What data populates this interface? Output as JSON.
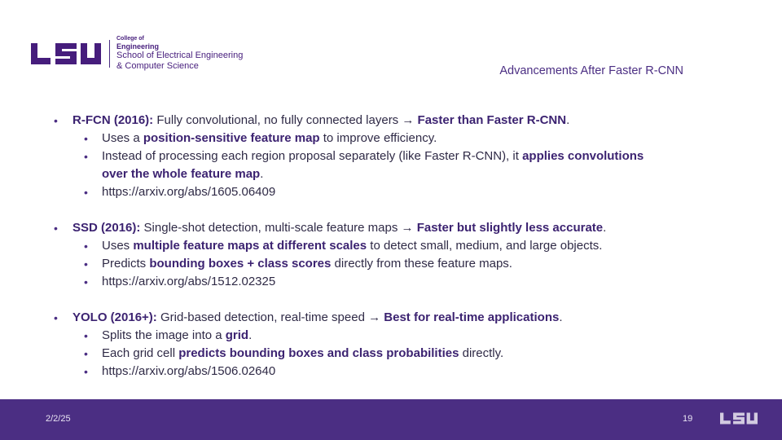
{
  "header": {
    "logo_text": "LSU",
    "college_of": "College of",
    "college_name": "Engineering",
    "school_line1": "School of Electrical Engineering",
    "school_line2": "& Computer Science",
    "slide_title": "Advancements After Faster R-CNN"
  },
  "sections": {
    "rfcn": {
      "name": "R-FCN (2016):",
      "text": " Fully convolutional, no fully connected layers → ",
      "bold_end": "Faster than Faster R-CNN",
      "tail": ".",
      "sub1_pre": "Uses a ",
      "sub1_bold": "position-sensitive feature map",
      "sub1_post": " to improve efficiency.",
      "sub2_pre": "Instead of processing each region proposal separately (like Faster R-CNN), it ",
      "sub2_bold1": "applies convolutions",
      "sub2_bold2": "over the whole feature map",
      "sub2_post": ".",
      "link": "https://arxiv.org/abs/1605.06409"
    },
    "ssd": {
      "name": "SSD (2016):",
      "text": " Single-shot detection, multi-scale feature maps → ",
      "bold_end": "Faster but slightly less accurate",
      "tail": ".",
      "sub1_pre": "Uses ",
      "sub1_bold": "multiple feature maps at different scales",
      "sub1_post": " to detect small, medium, and large objects.",
      "sub2_pre": "Predicts ",
      "sub2_bold": "bounding boxes + class scores",
      "sub2_post": " directly from these feature maps.",
      "link": "https://arxiv.org/abs/1512.02325"
    },
    "yolo": {
      "name": "YOLO (2016+):",
      "text": " Grid-based detection, real-time speed → ",
      "bold_end": "Best for real-time applications",
      "tail": ".",
      "sub1_pre": "Splits the image into a ",
      "sub1_bold": "grid",
      "sub1_post": ".",
      "sub2_pre": "Each grid cell ",
      "sub2_bold": "predicts bounding boxes and class probabilities",
      "sub2_post": " directly.",
      "link": "https://arxiv.org/abs/1506.02640"
    }
  },
  "bullet_char": "•",
  "footer": {
    "date": "2/2/25",
    "page_number": "19",
    "logo_text": "LSU"
  },
  "colors": {
    "brand_purple": "#4b2e83",
    "logo_purple": "#461d7c"
  }
}
